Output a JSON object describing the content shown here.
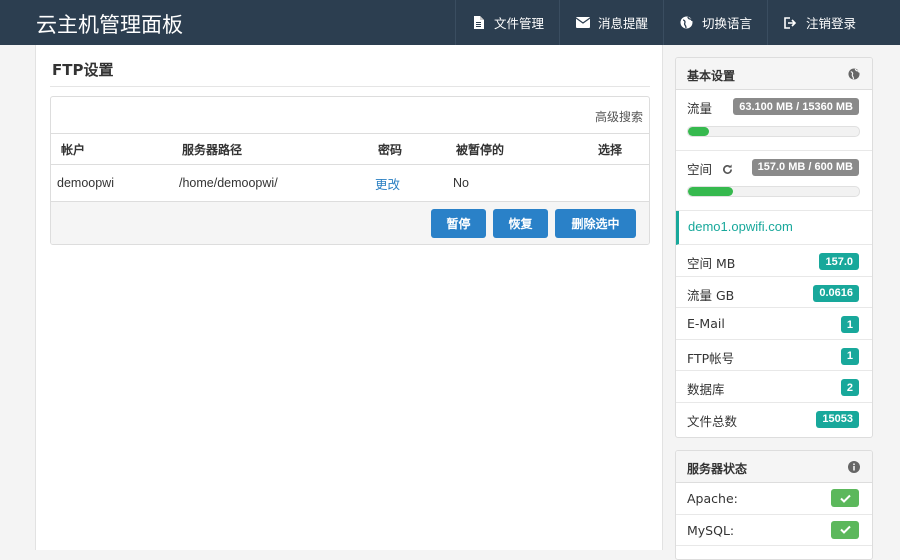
{
  "navbar": {
    "brand": "云主机管理面板",
    "items": [
      {
        "label": "文件管理",
        "icon": "file-icon"
      },
      {
        "label": "消息提醒",
        "icon": "envelope-icon"
      },
      {
        "label": "切换语言",
        "icon": "globe-icon"
      },
      {
        "label": "注销登录",
        "icon": "sign-out-icon"
      }
    ]
  },
  "page": {
    "title": "FTP设置"
  },
  "ftp_panel": {
    "advanced_search": "高级搜索",
    "columns": [
      "帐户",
      "服务器路径",
      "密码",
      "被暂停的",
      "选择"
    ],
    "rows": [
      {
        "account": "demoopwi",
        "path": "/home/demoopwi/",
        "password_action": "更改",
        "suspended": "No"
      }
    ],
    "buttons": {
      "suspend": "暂停",
      "restore": "恢复",
      "delete_selected": "删除选中"
    }
  },
  "basic_settings": {
    "title": "基本设置",
    "traffic_label": "流量",
    "traffic_value": "63.100 MB / 15360 MB",
    "traffic_fraction": 0.0041,
    "space_label": "空间",
    "space_value": "157.0 MB / 600 MB",
    "space_fraction": 0.262,
    "domain": "demo1.opwifi.com",
    "stats": [
      {
        "label": "空间 MB",
        "value": "157.0"
      },
      {
        "label": "流量 GB",
        "value": "0.0616"
      },
      {
        "label": "E-Mail",
        "value": "1"
      },
      {
        "label": "FTP帐号",
        "value": "1"
      },
      {
        "label": "数据库",
        "value": "2"
      },
      {
        "label": "文件总数",
        "value": "15053"
      }
    ]
  },
  "server_status": {
    "title": "服务器状态",
    "services": [
      {
        "label": "Apache:",
        "status": "ok"
      },
      {
        "label": "MySQL:",
        "status": "ok"
      }
    ]
  },
  "colors": {
    "navbar": "#2c3e50",
    "primary": "#2a81c8",
    "teal": "#18a89b",
    "success": "#5cb85c"
  }
}
